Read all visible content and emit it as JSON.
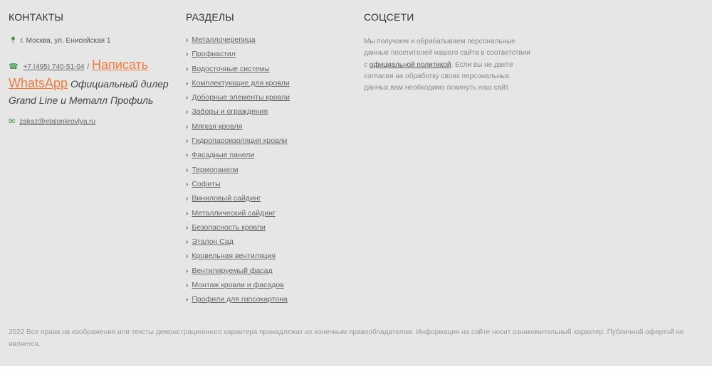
{
  "contacts": {
    "heading": "КОНТАКТЫ",
    "address": "г. Москва, ул. Енисейская 1",
    "phone": "+7 (495) 740-51-04",
    "separator": "/",
    "whatsapp_label": "Написать WhatsApp",
    "dealer_text": "Официальный дилер Grand Line и Металл Профиль",
    "email": "zakaz@etalonkrovlya.ru"
  },
  "sections": {
    "heading": "РАЗДЕЛЫ",
    "items": [
      "Металлочерепица",
      "Профнастил",
      "Водосточные системы",
      "Комплектующие для кровли",
      "Доборные элементы кровли",
      "Заборы и ограждения",
      "Мягкая кровля",
      "Гидропароизоляция кровли",
      "Фасадные панели",
      "Термопанели",
      "Софиты",
      "Виниловый сайдинг",
      "Металлический сайдинг",
      "Безопасность кровли",
      "Эталон Сад",
      "Кровельная вентиляция",
      "Вентилируемый фасад",
      "Монтаж кровли и фасадов",
      "Профили для гипсокартона"
    ]
  },
  "social": {
    "heading": "СОЦСЕТИ",
    "policy_text_before": "Мы получаем и обрабатываем персональные данные посетителей нашего сайта в соответствии с ",
    "policy_link": "официальной политикой",
    "policy_text_after": ". Если вы не даете согласия на обработку своих персональных данных,вам необходимо покинуть наш сайт."
  },
  "footer": {
    "copyright": "2022 Все права на изображения или тексты демонстрационного характера принадлежат их конечным правообладателям. Информация на сайте носит ознакомительный характер. Публичной офертой не является."
  },
  "colors": {
    "background": "#e6e6e6",
    "accent_icon": "#3a9a44",
    "whatsapp": "#f07a38"
  },
  "icons": {
    "address": "map-pin-icon",
    "phone": "phone-icon",
    "email": "mail-icon",
    "menu_item": "chevron-right-icon"
  }
}
